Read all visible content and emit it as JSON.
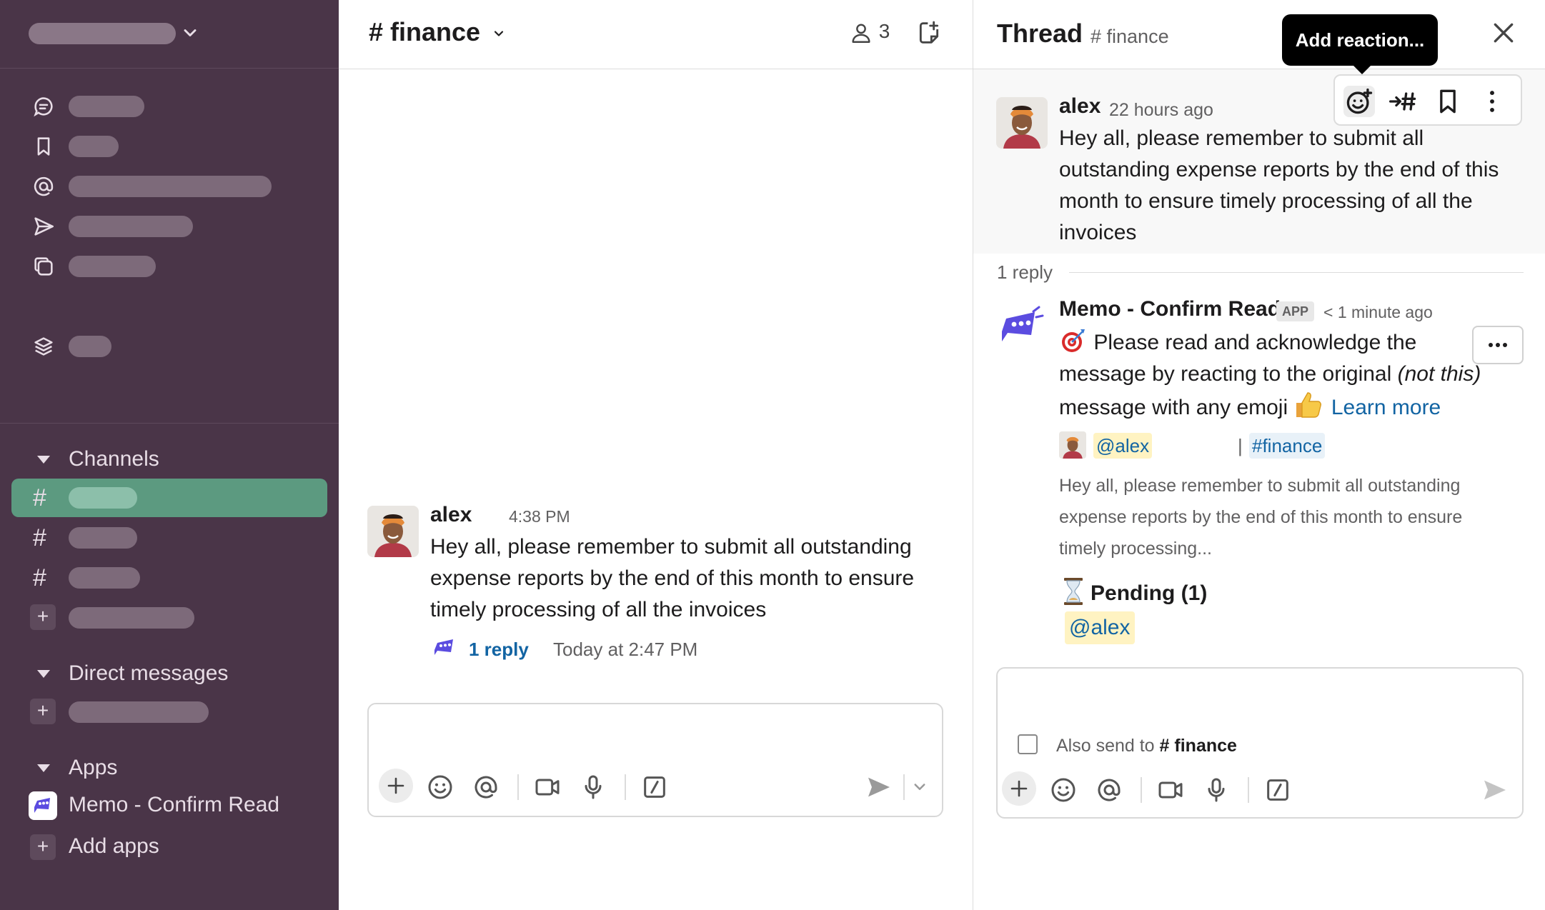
{
  "colors": {
    "sidebar_bg": "#4a3548",
    "active_channel": "#5c9a80",
    "link": "#1264a3",
    "mention_bg": "#fff3c2"
  },
  "sidebar": {
    "nav_icons": [
      "threads-icon",
      "bookmark-icon",
      "mentions-icon",
      "send-icon",
      "drafts-icon",
      "layers-icon"
    ],
    "sections": {
      "channels": "Channels",
      "direct_messages": "Direct messages",
      "apps": "Apps"
    },
    "channel_hash": "#",
    "add_symbol": "+",
    "apps": {
      "memo": "Memo - Confirm Read",
      "add_apps": "Add apps"
    }
  },
  "channel": {
    "hash": "#",
    "name": "finance",
    "member_count": "3",
    "message": {
      "author": "alex",
      "time": "4:38 PM",
      "text": "Hey all, please remember to submit all outstanding expense reports by the end of this month to ensure timely processing of all the invoices",
      "reply_link": "1 reply",
      "reply_time": "Today at 2:47 PM"
    }
  },
  "thread": {
    "title": "Thread",
    "channel": "# finance",
    "tooltip": "Add reaction...",
    "root": {
      "author": "alex",
      "time": "22 hours ago",
      "text": "Hey all, please remember to submit all outstanding expense reports by the end of this month to ensure timely processing of all the invoices"
    },
    "reply_count": "1 reply",
    "app_reply": {
      "author": "Memo - Confirm Read",
      "badge": "APP",
      "time": "< 1 minute ago",
      "text_1": " Please read and acknowledge the message by reacting to the original ",
      "text_italic": "(not this)",
      "text_2": " message with any emoji ",
      "learn_more": "Learn more",
      "mention_user": "@alex",
      "pipe": "|",
      "mention_channel": "#finance",
      "quote": "Hey all, please remember to submit all outstanding expense reports by the end of this month to ensure timely processing...",
      "pending_label": "Pending (1)",
      "pending_user": "@alex"
    },
    "composer": {
      "also_send_prefix": "Also send to",
      "also_send_channel": "# finance"
    }
  }
}
